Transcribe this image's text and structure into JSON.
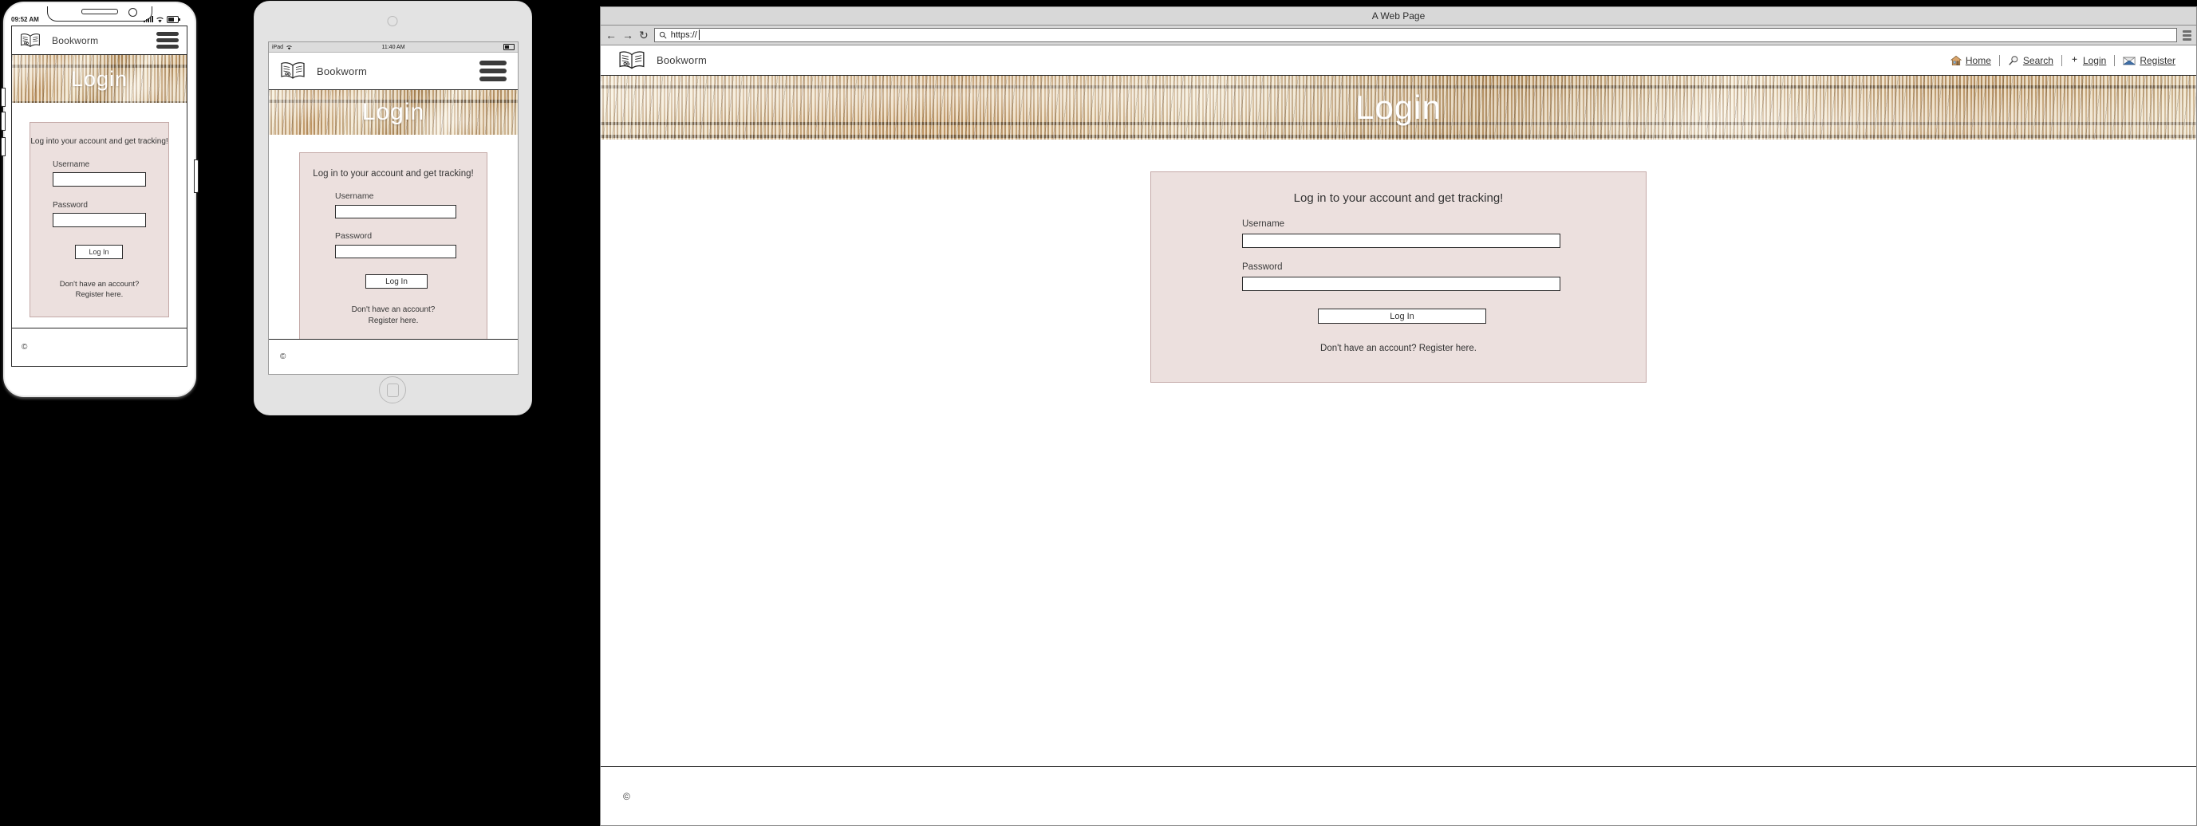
{
  "brand": {
    "name": "Bookworm",
    "logo_icon": "open-book-icon"
  },
  "phone": {
    "status": {
      "time": "09:52 AM",
      "signal_icon": "cellular-signal-icon",
      "wifi_icon": "wifi-icon",
      "battery_icon": "battery-icon"
    },
    "menu_icon": "hamburger-menu-icon",
    "hero_title": "Login",
    "card": {
      "title": "Log into your account and get tracking!",
      "username_label": "Username",
      "password_label": "Password",
      "username_value": "",
      "password_value": "",
      "login_button": "Log In",
      "register_line1": "Don't have an account?",
      "register_line2": "Register here."
    },
    "footer": {
      "copyright": "©"
    }
  },
  "tablet": {
    "status": {
      "device": "iPad",
      "wifi_icon": "wifi-icon",
      "time": "11:40 AM",
      "battery_icon": "battery-icon"
    },
    "menu_icon": "hamburger-menu-icon",
    "hero_title": "Login",
    "card": {
      "title": "Log in to your account and get tracking!",
      "username_label": "Username",
      "password_label": "Password",
      "username_value": "",
      "password_value": "",
      "login_button": "Log In",
      "register_line1": "Don't have an account?",
      "register_line2": "Register here."
    },
    "footer": {
      "copyright": "©"
    },
    "home_button_icon": "home-button-icon"
  },
  "desktop": {
    "window_title": "A Web Page",
    "browser": {
      "back_icon": "back-arrow-icon",
      "forward_icon": "forward-arrow-icon",
      "reload_icon": "reload-icon",
      "url_search_icon": "search-icon",
      "url_value": "https://",
      "url_placeholder": "https://",
      "menu_icon": "browser-menu-icon"
    },
    "nav": [
      {
        "label": "Home",
        "icon": "house-icon"
      },
      {
        "label": "Search",
        "icon": "magnifier-icon"
      },
      {
        "label": "Login",
        "icon": "plus-icon"
      },
      {
        "label": "Register",
        "icon": "envelope-icon"
      }
    ],
    "hero_title": "Login",
    "card": {
      "title": "Log in to your account and get tracking!",
      "username_label": "Username",
      "password_label": "Password",
      "username_value": "",
      "password_value": "",
      "login_button": "Log In",
      "register_note": "Don't have an account?  Register here."
    },
    "footer": {
      "copyright": "©"
    }
  },
  "colors": {
    "card_bg": "#ece0de",
    "card_border": "#c4a9a7",
    "text": "#333333",
    "chrome_gray": "#d8d8d8",
    "tablet_body": "#e3e3e3"
  }
}
